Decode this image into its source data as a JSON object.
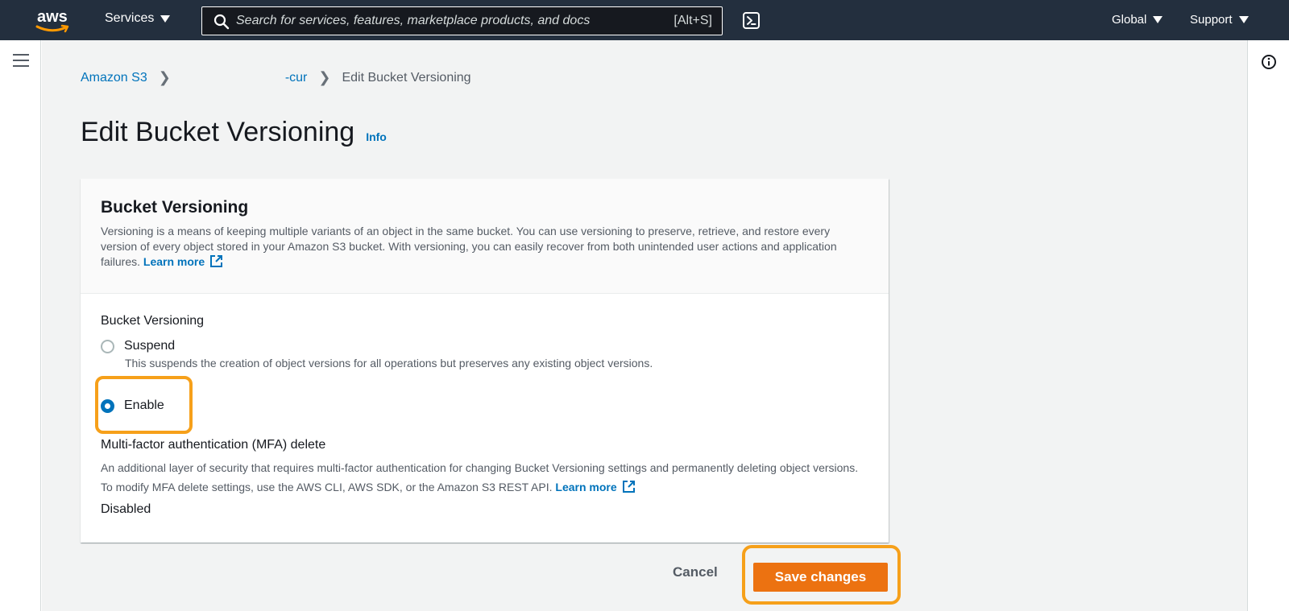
{
  "topnav": {
    "logo_text": "aws",
    "services_label": "Services",
    "search_placeholder": "Search for services, features, marketplace products, and docs",
    "search_shortcut": "[Alt+S]",
    "global_label": "Global",
    "support_label": "Support",
    "icons": [
      "search-icon",
      "cloudshell-icon",
      "caret-down-icon"
    ]
  },
  "breadcrumb": {
    "items": [
      "Amazon S3",
      "-cur",
      "Edit Bucket Versioning"
    ]
  },
  "page": {
    "title": "Edit Bucket Versioning",
    "info_label": "Info"
  },
  "panel": {
    "title": "Bucket Versioning",
    "description": "Versioning is a means of keeping multiple variants of an object in the same bucket. You can use versioning to preserve, retrieve, and restore every version of every object stored in your Amazon S3 bucket. With versioning, you can easily recover from both unintended user actions and application failures.",
    "learn_more": "Learn more",
    "field_label": "Bucket Versioning",
    "options": [
      {
        "label": "Suspend",
        "description": "This suspends the creation of object versions for all operations but preserves any existing object versions.",
        "selected": false
      },
      {
        "label": "Enable",
        "selected": true
      }
    ],
    "mfa_label": "Multi-factor authentication (MFA) delete",
    "mfa_description": "An additional layer of security that requires multi-factor authentication for changing Bucket Versioning settings and permanently deleting object versions. To modify MFA delete settings, use the AWS CLI, AWS SDK, or the Amazon S3 REST API.",
    "mfa_learn_more": "Learn more",
    "mfa_value": "Disabled"
  },
  "actions": {
    "cancel_label": "Cancel",
    "save_label": "Save changes"
  },
  "colors": {
    "nav_bg": "#232f3e",
    "link": "#0073bb",
    "primary_button": "#ec7211",
    "highlight": "#f6a01a",
    "page_bg": "#f2f3f3"
  }
}
